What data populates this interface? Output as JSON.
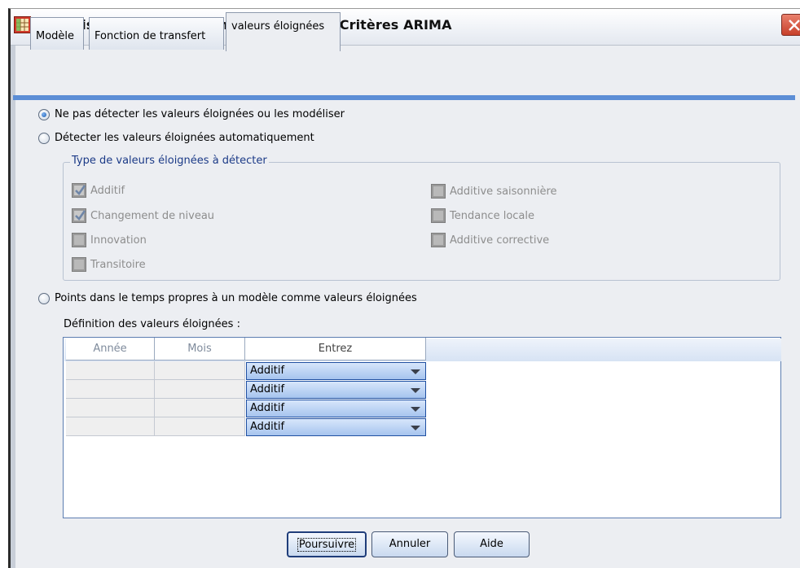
{
  "window": {
    "title": "Modélisateur de séries chronologiques : Critères ARIMA",
    "close_label": "X"
  },
  "tabs": [
    {
      "label": "Modèle",
      "active": false
    },
    {
      "label": "Fonction de transfert",
      "active": false
    },
    {
      "label": "valeurs éloignées",
      "active": true
    }
  ],
  "radios": {
    "no_detect": {
      "label": "Ne pas détecter les valeurs éloignées ou les modéliser",
      "checked": true
    },
    "auto_detect": {
      "label": "Détecter les valeurs éloignées automatiquement",
      "checked": false
    },
    "specific_points": {
      "label": "Points dans le temps propres à un modèle comme valeurs éloignées",
      "checked": false
    }
  },
  "outlier_types": {
    "title": "Type de valeurs éloignées à détecter",
    "additive": {
      "label": "Additif",
      "checked": true
    },
    "level_shift": {
      "label": "Changement de niveau",
      "checked": true
    },
    "innovational": {
      "label": "Innovation",
      "checked": false
    },
    "transient": {
      "label": "Transitoire",
      "checked": false
    },
    "seasonal_additive": {
      "label": "Additive saisonnière",
      "checked": false
    },
    "local_trend": {
      "label": "Tendance locale",
      "checked": false
    },
    "additive_patch": {
      "label": "Additive corrective",
      "checked": false
    }
  },
  "definition": {
    "label": "Définition des valeurs éloignées :",
    "columns": [
      "Année",
      "Mois",
      "Entrez"
    ],
    "rows": [
      {
        "year": "",
        "month": "",
        "type": "Additif"
      },
      {
        "year": "",
        "month": "",
        "type": "Additif"
      },
      {
        "year": "",
        "month": "",
        "type": "Additif"
      },
      {
        "year": "",
        "month": "",
        "type": "Additif"
      }
    ]
  },
  "buttons": {
    "continue": "Poursuivre",
    "cancel": "Annuler",
    "help": "Aide"
  },
  "colors": {
    "accent": "#5c8ed6",
    "combo": "#a6c4ee",
    "close": "#c7402a"
  }
}
